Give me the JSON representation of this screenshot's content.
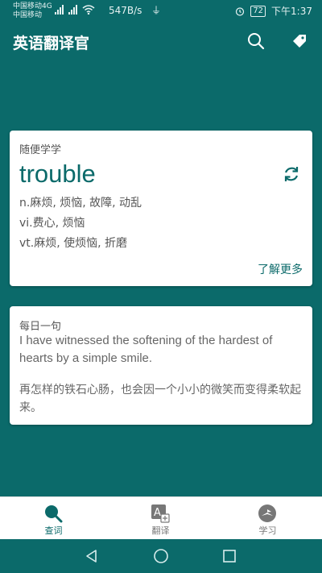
{
  "status_bar": {
    "carrier_line1": "中国移动4G",
    "carrier_line2": "中国移动",
    "network_speed": "547B/s",
    "battery": "72",
    "time": "下午1:37"
  },
  "app_bar": {
    "title": "英语翻译官",
    "icons": [
      "search-icon",
      "tag-icon"
    ]
  },
  "word_card": {
    "label": "随便学学",
    "word": "trouble",
    "definitions": [
      "n.麻烦, 烦恼, 故障, 动乱",
      "vi.费心, 烦恼",
      "vt.麻烦, 使烦恼, 折磨"
    ],
    "learn_more": "了解更多"
  },
  "daily_card": {
    "label": "每日一句",
    "sentence": "I have witnessed the softening of the hardest of hearts by a simple smile.",
    "translation": "再怎样的铁石心肠，也会因一个小小的微笑而变得柔软起来。"
  },
  "bottom_nav": {
    "items": [
      {
        "label": "查词",
        "icon": "search-icon",
        "active": true
      },
      {
        "label": "翻译",
        "icon": "translate-icon",
        "active": false
      },
      {
        "label": "学习",
        "icon": "study-icon",
        "active": false
      }
    ]
  },
  "colors": {
    "primary": "#0b6a6a",
    "card_bg": "#ffffff",
    "text_secondary": "#555555"
  }
}
